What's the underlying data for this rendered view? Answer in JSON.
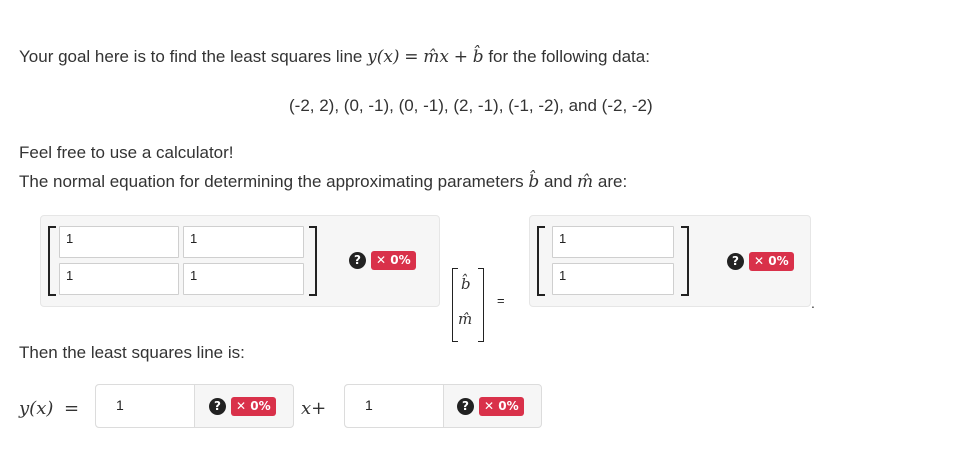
{
  "intro": {
    "prefix": "Your goal here is to find the least squares line ",
    "eq_lhs": "y(x)",
    "eq_eq": "=",
    "eq_rhs_m": "m̂x",
    "eq_plus": "+",
    "eq_rhs_b": "b̂",
    "suffix": " for the following data:"
  },
  "data_points": "(-2, 2), (0, -1), (0, -1), (2, -1), (-1, -2), and (-2, -2)",
  "calculator_note": "Feel free to use a calculator!",
  "normal_eq": {
    "prefix": "The normal equation for determining the approximating parameters ",
    "b_hat": "b̂",
    "and": " and ",
    "m_hat": "m̂",
    "suffix": " are:"
  },
  "matrix_left": {
    "r1c1": "1",
    "r1c2": "1",
    "r2c1": "1",
    "r2c2": "1"
  },
  "vector_unknowns": {
    "top": "b̂",
    "bottom": "m̂"
  },
  "equals_sign": "=",
  "vector_right": {
    "r1": "1",
    "r2": "1"
  },
  "trailing_period": ".",
  "feedback": {
    "help_glyph": "?",
    "score": "✕ 0%"
  },
  "least_squares": {
    "label": "Then the least squares line is:",
    "lhs": "y(x)",
    "eq": "=",
    "slope_value": "1",
    "x_plus": "x+",
    "intercept_value": "1"
  }
}
